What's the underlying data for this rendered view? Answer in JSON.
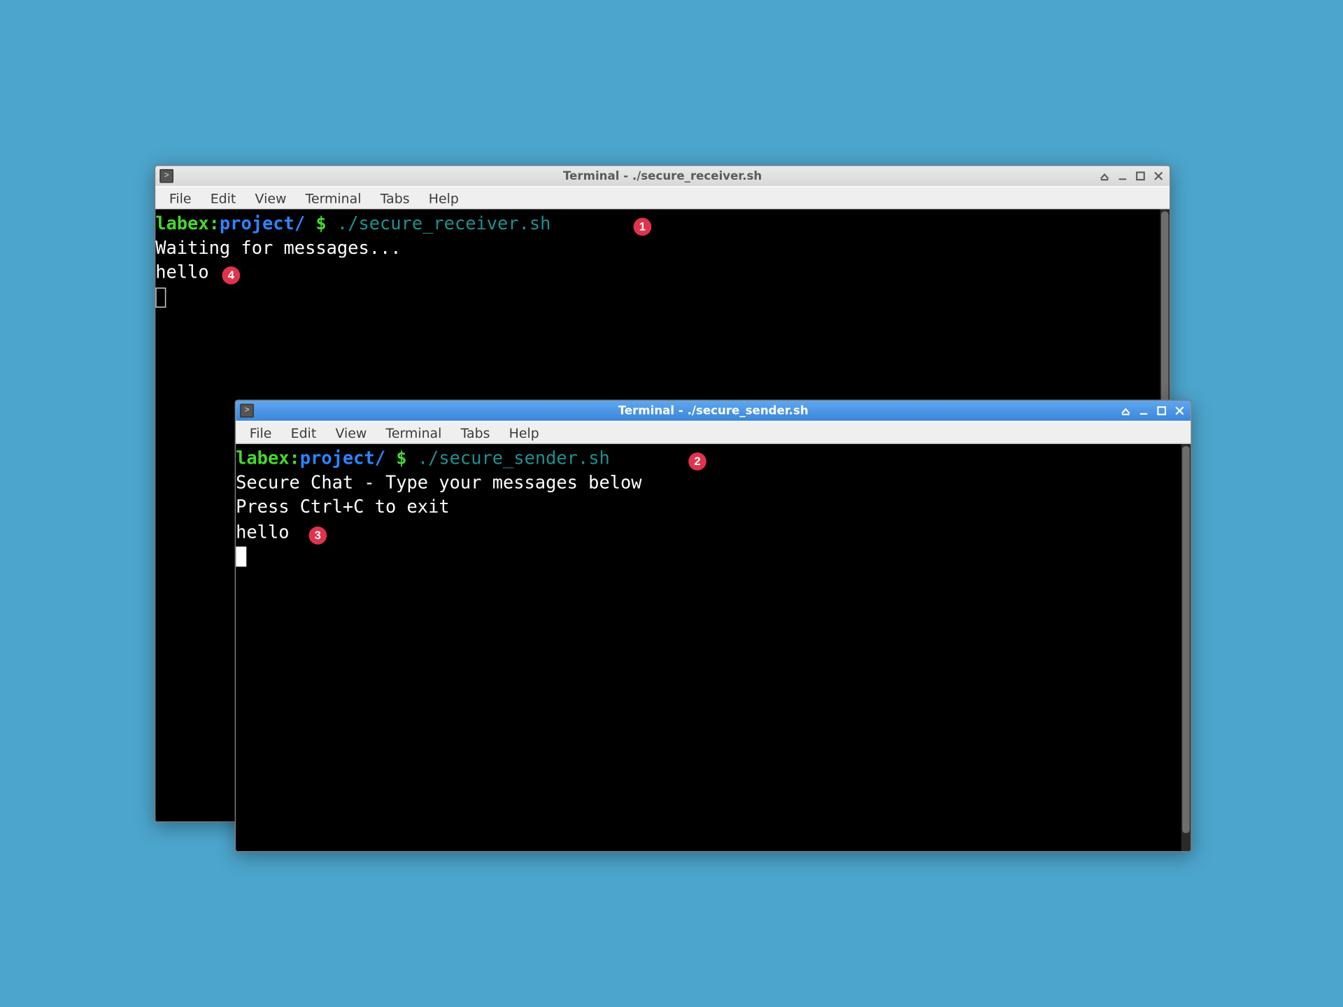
{
  "windows": {
    "receiver": {
      "title": "Terminal - ./secure_receiver.sh",
      "active": false,
      "menubar": [
        "File",
        "Edit",
        "View",
        "Terminal",
        "Tabs",
        "Help"
      ],
      "prompt": {
        "user": "labex",
        "sep": ":",
        "path": "project/",
        "symbol": " $ "
      },
      "command": "./secure_receiver.sh",
      "output": [
        "Waiting for messages...",
        "hello"
      ]
    },
    "sender": {
      "title": "Terminal - ./secure_sender.sh",
      "active": true,
      "menubar": [
        "File",
        "Edit",
        "View",
        "Terminal",
        "Tabs",
        "Help"
      ],
      "prompt": {
        "user": "labex",
        "sep": ":",
        "path": "project/",
        "symbol": " $ "
      },
      "command": "./secure_sender.sh",
      "output": [
        "Secure Chat - Type your messages below",
        "Press Ctrl+C to exit",
        "hello"
      ]
    }
  },
  "annotations": {
    "a1": "1",
    "a2": "2",
    "a3": "3",
    "a4": "4"
  }
}
